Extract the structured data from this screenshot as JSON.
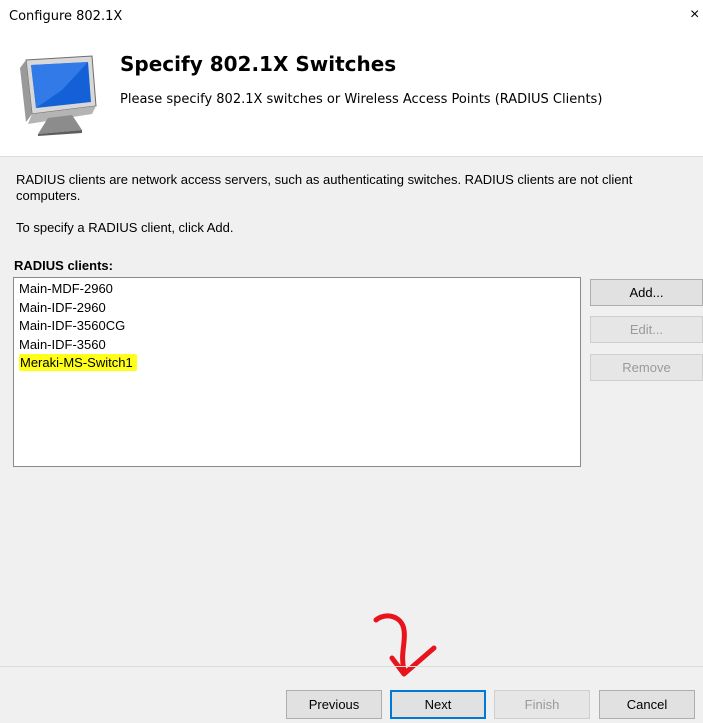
{
  "window": {
    "title": "Configure 802.1X",
    "close_glyph": "×"
  },
  "header": {
    "title": "Specify 802.1X Switches",
    "subtitle": "Please specify 802.1X switches or Wireless Access Points (RADIUS Clients)",
    "icon": "monitor-icon"
  },
  "body": {
    "description": "RADIUS clients are network access servers, such as authenticating switches. RADIUS clients are not client computers.",
    "instruction": "To specify a RADIUS client, click Add.",
    "list_label": "RADIUS clients:",
    "clients": [
      "Main-MDF-2960",
      "Main-IDF-2960",
      "Main-IDF-3560CG",
      "Main-IDF-3560",
      "Meraki-MS-Switch1"
    ],
    "highlight_color": "#ffff1a"
  },
  "side_buttons": {
    "add": "Add...",
    "edit": "Edit...",
    "remove": "Remove"
  },
  "footer": {
    "previous": "Previous",
    "next": "Next",
    "finish": "Finish",
    "cancel": "Cancel"
  },
  "annotation": {
    "arrow_color": "#e8141b"
  }
}
